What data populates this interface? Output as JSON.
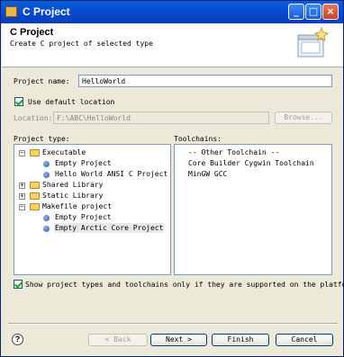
{
  "window": {
    "title": "C Project"
  },
  "header": {
    "title": "C Project",
    "subtitle": "Create C project of selected type"
  },
  "project_name": {
    "label": "Project name:",
    "value": "HelloWorld"
  },
  "default_location": {
    "label": "Use default location",
    "checked": true
  },
  "location": {
    "label": "Location:",
    "value": "F:\\ABC\\HelloWorld",
    "browse_label": "Browse..."
  },
  "project_type": {
    "label": "Project type:",
    "items": [
      {
        "label": "Executable",
        "kind": "folder",
        "expanded": true
      },
      {
        "label": "Empty Project",
        "kind": "leaf"
      },
      {
        "label": "Hello World ANSI C Project",
        "kind": "leaf"
      },
      {
        "label": "Shared Library",
        "kind": "folder",
        "expanded": false
      },
      {
        "label": "Static Library",
        "kind": "folder",
        "expanded": false
      },
      {
        "label": "Makefile project",
        "kind": "folder",
        "expanded": true
      },
      {
        "label": "Empty Project",
        "kind": "leaf"
      },
      {
        "label": "Empty Arctic Core Project",
        "kind": "leaf",
        "selected": true
      }
    ]
  },
  "toolchains": {
    "label": "Toolchains:",
    "items": [
      "-- Other Toolchain --",
      "Core Builder Cygwin Toolchain",
      "MinGW GCC"
    ]
  },
  "filter": {
    "label": "Show project types and toolchains only if they are supported on the platform",
    "checked": true
  },
  "buttons": {
    "back": "< Back",
    "next": "Next >",
    "finish": "Finish",
    "cancel": "Cancel"
  }
}
